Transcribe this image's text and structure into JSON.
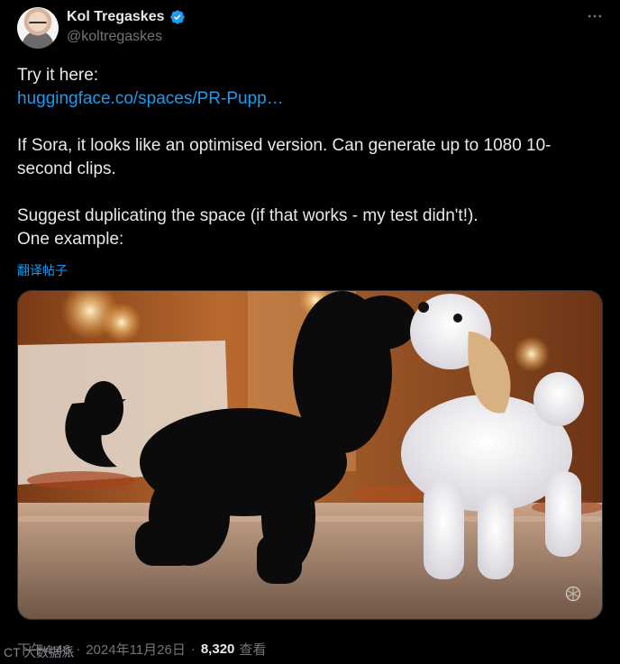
{
  "author": {
    "display_name": "Kol Tregaskes",
    "handle": "@koltregaskes",
    "verified": true
  },
  "tweet": {
    "line1": "Try it here:",
    "link": "huggingface.co/spaces/PR-Pupp…",
    "line2": "If Sora, it looks like an optimised version.  Can generate up to 1080 10-second clips.",
    "line3": "Suggest duplicating the space (if that works - my test didn't!).",
    "line4": "One example:"
  },
  "translate_label": "翻译帖子",
  "meta": {
    "time": "下午4:46",
    "date": "2024年11月26日",
    "separator": "·",
    "views_count": "8,320",
    "views_label": "查看"
  },
  "overlay_tag": "CT 大数据派",
  "colors": {
    "background": "#000000",
    "text": "#e7e9ea",
    "secondary_text": "#71767b",
    "link": "#1d9bf0",
    "verified": "#1d9bf0"
  },
  "icons": {
    "verified": "verified-badge-icon",
    "more": "more-options-icon",
    "watermark": "openai-logo-icon"
  }
}
